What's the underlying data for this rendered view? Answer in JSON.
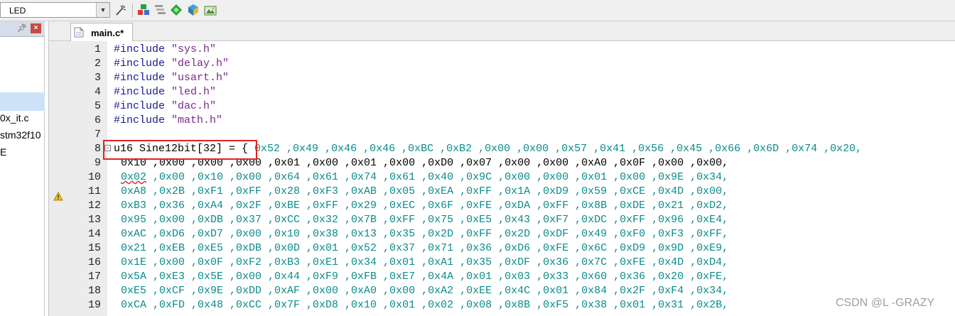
{
  "toolbar": {
    "target": "LED",
    "icons": [
      "magic-wand-icon",
      "pack-installer-icon",
      "manage-components-icon",
      "rte-icon",
      "extensions-icon",
      "select-packs-icon"
    ]
  },
  "left_panel": {
    "items": [
      "0x_it.c",
      "stm32f10",
      "E"
    ]
  },
  "tab": {
    "label": "main.c*"
  },
  "code": {
    "includes": [
      {
        "kw": "#include",
        "file": "\"sys.h\""
      },
      {
        "kw": "#include",
        "file": "\"delay.h\""
      },
      {
        "kw": "#include",
        "file": "\"usart.h\""
      },
      {
        "kw": "#include",
        "file": "\"led.h\""
      },
      {
        "kw": "#include",
        "file": "\"dac.h\""
      },
      {
        "kw": "#include",
        "file": "\"math.h\""
      }
    ],
    "decl": "u16 Sine12bit[32] = ",
    "brace": "{",
    "line_numbers": [
      "1",
      "2",
      "3",
      "4",
      "5",
      "6",
      "7",
      "8",
      "9",
      "10",
      "11",
      "12",
      "13",
      "14",
      "15",
      "16",
      "17",
      "18",
      "19"
    ],
    "line8_values": " 0x52 ,0x49 ,0x46 ,0x46 ,0xBC ,0xB2 ,0x00 ,0x00 ,0x57 ,0x41 ,0x56 ,0x45 ,0x66 ,0x6D ,0x74 ,0x20,",
    "line9": "0x10 ,0x00 ,0x00 ,0x00 ,0x01 ,0x00 ,0x01 ,0x00 ,0xD0 ,0x07 ,0x00 ,0x00 ,0xA0 ,0x0F ,0x00 ,0x00,",
    "line10_first": "0x02",
    "line10_rest": " ,0x00 ,0x10 ,0x00 ,0x64 ,0x61 ,0x74 ,0x61 ,0x40 ,0x9C ,0x00 ,0x00 ,0x01 ,0x00 ,0x9E ,0x34,",
    "lines": [
      "0xA8 ,0x2B ,0xF1 ,0xFF ,0x28 ,0xF3 ,0xAB ,0x05 ,0xEA ,0xFF ,0x1A ,0xD9 ,0x59 ,0xCE ,0x4D ,0x00,",
      "0xB3 ,0x36 ,0xA4 ,0x2F ,0xBE ,0xFF ,0x29 ,0xEC ,0x6F ,0xFE ,0xDA ,0xFF ,0x8B ,0xDE ,0x21 ,0xD2,",
      "0x95 ,0x00 ,0xDB ,0x37 ,0xCC ,0x32 ,0x7B ,0xFF ,0x75 ,0xE5 ,0x43 ,0xF7 ,0xDC ,0xFF ,0x96 ,0xE4,",
      "0xAC ,0xD6 ,0xD7 ,0x00 ,0x10 ,0x38 ,0x13 ,0x35 ,0x2D ,0xFF ,0x2D ,0xDF ,0x49 ,0xF0 ,0xF3 ,0xFF,",
      "0x21 ,0xEB ,0xE5 ,0xDB ,0x0D ,0x01 ,0x52 ,0x37 ,0x71 ,0x36 ,0xD6 ,0xFE ,0x6C ,0xD9 ,0x9D ,0xE9,",
      "0x1E ,0x00 ,0x0F ,0xF2 ,0xB3 ,0xE1 ,0x34 ,0x01 ,0xA1 ,0x35 ,0xDF ,0x36 ,0x7C ,0xFE ,0x4D ,0xD4,",
      "0x5A ,0xE3 ,0x5E ,0x00 ,0x44 ,0xF9 ,0xFB ,0xE7 ,0x4A ,0x01 ,0x03 ,0x33 ,0x60 ,0x36 ,0x20 ,0xFE,",
      "0xE5 ,0xCF ,0x9E ,0xDD ,0xAF ,0x00 ,0xA0 ,0x00 ,0xA2 ,0xEE ,0x4C ,0x01 ,0x84 ,0x2F ,0xF4 ,0x34,",
      "0xCA ,0xFD ,0x48 ,0xCC ,0x7F ,0xD8 ,0x10 ,0x01 ,0x02 ,0x08 ,0x8B ,0xF5 ,0x38 ,0x01 ,0x31 ,0x2B,"
    ]
  },
  "watermark": "CSDN @L -GRAZY"
}
